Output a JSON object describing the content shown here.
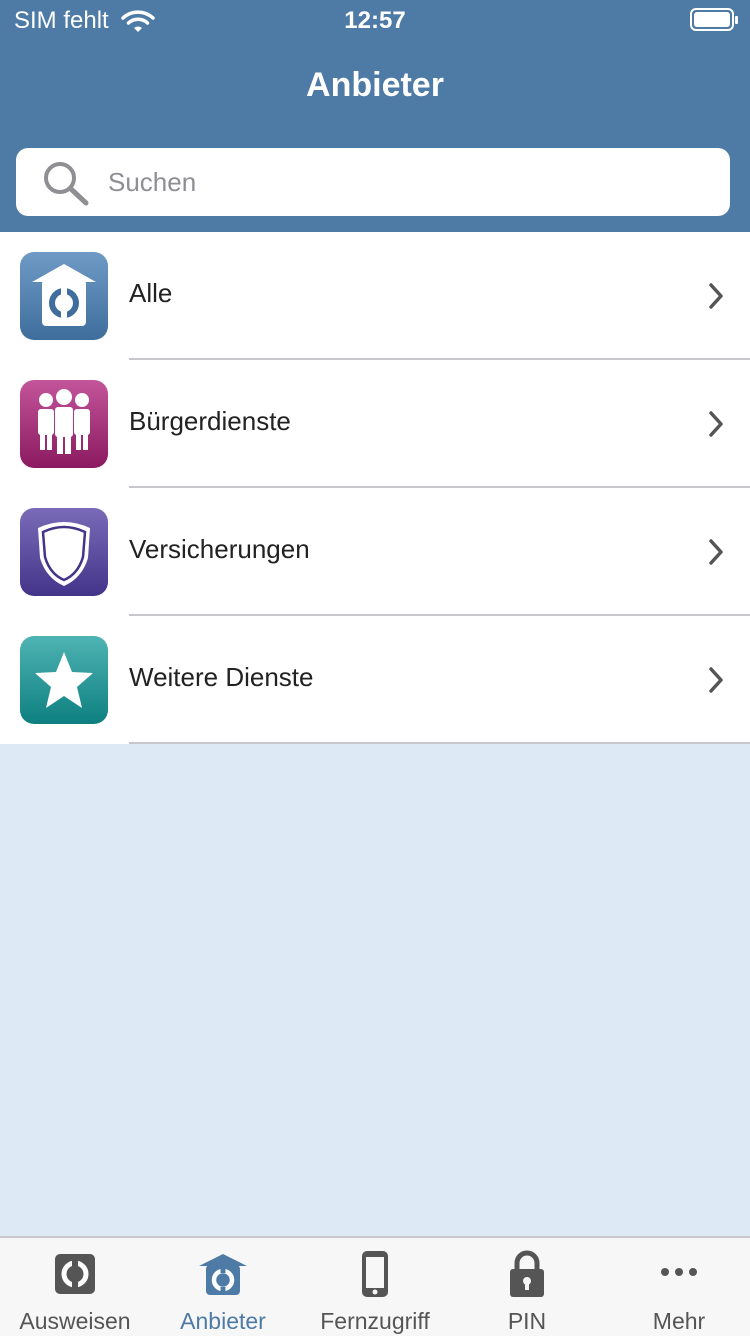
{
  "status_bar": {
    "carrier": "SIM fehlt",
    "time": "12:57"
  },
  "nav": {
    "title": "Anbieter"
  },
  "search": {
    "placeholder": "Suchen",
    "value": ""
  },
  "list": [
    {
      "label": "Alle",
      "icon": "house-logo-icon",
      "color": "#4a7fb0"
    },
    {
      "label": "Bürgerdienste",
      "icon": "people-icon",
      "color": "#9c1f6c"
    },
    {
      "label": "Versicherungen",
      "icon": "shield-icon",
      "color": "#4d3d93"
    },
    {
      "label": "Weitere Dienste",
      "icon": "star-icon",
      "color": "#10888a"
    }
  ],
  "tabs": [
    {
      "label": "Ausweisen",
      "icon": "id-card-icon",
      "active": false
    },
    {
      "label": "Anbieter",
      "icon": "house-logo-icon",
      "active": true
    },
    {
      "label": "Fernzugriff",
      "icon": "phone-icon",
      "active": false
    },
    {
      "label": "PIN",
      "icon": "lock-icon",
      "active": false
    },
    {
      "label": "Mehr",
      "icon": "more-icon",
      "active": false
    }
  ],
  "colors": {
    "header": "#4e7aa6",
    "background": "#dde9f4",
    "tab_active": "#4e7aa6",
    "tab_inactive": "#555555"
  }
}
